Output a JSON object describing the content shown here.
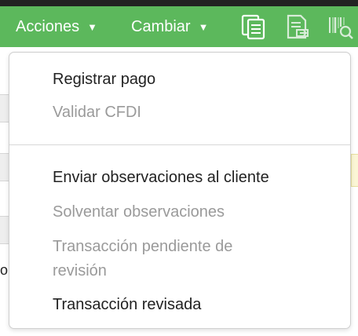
{
  "toolbar": {
    "actions_label": "Acciones",
    "change_label": "Cambiar",
    "caret": "▼",
    "accent_color": "#5cb85c"
  },
  "background": {
    "partial_char": "o"
  },
  "dropdown": {
    "items": [
      {
        "label": "Registrar pago",
        "enabled": true
      },
      {
        "label": "Validar CFDI",
        "enabled": false
      },
      {
        "label": "Enviar observaciones al cliente",
        "enabled": true
      },
      {
        "label": "Solventar observaciones",
        "enabled": false
      },
      {
        "label": "Transacción pendiente de",
        "label_line2": "revisión",
        "enabled": false
      },
      {
        "label": "Transacción revisada",
        "enabled": true
      }
    ]
  },
  "icons": [
    "copy-document-icon",
    "document-export-icon",
    "barcode-search-icon"
  ]
}
